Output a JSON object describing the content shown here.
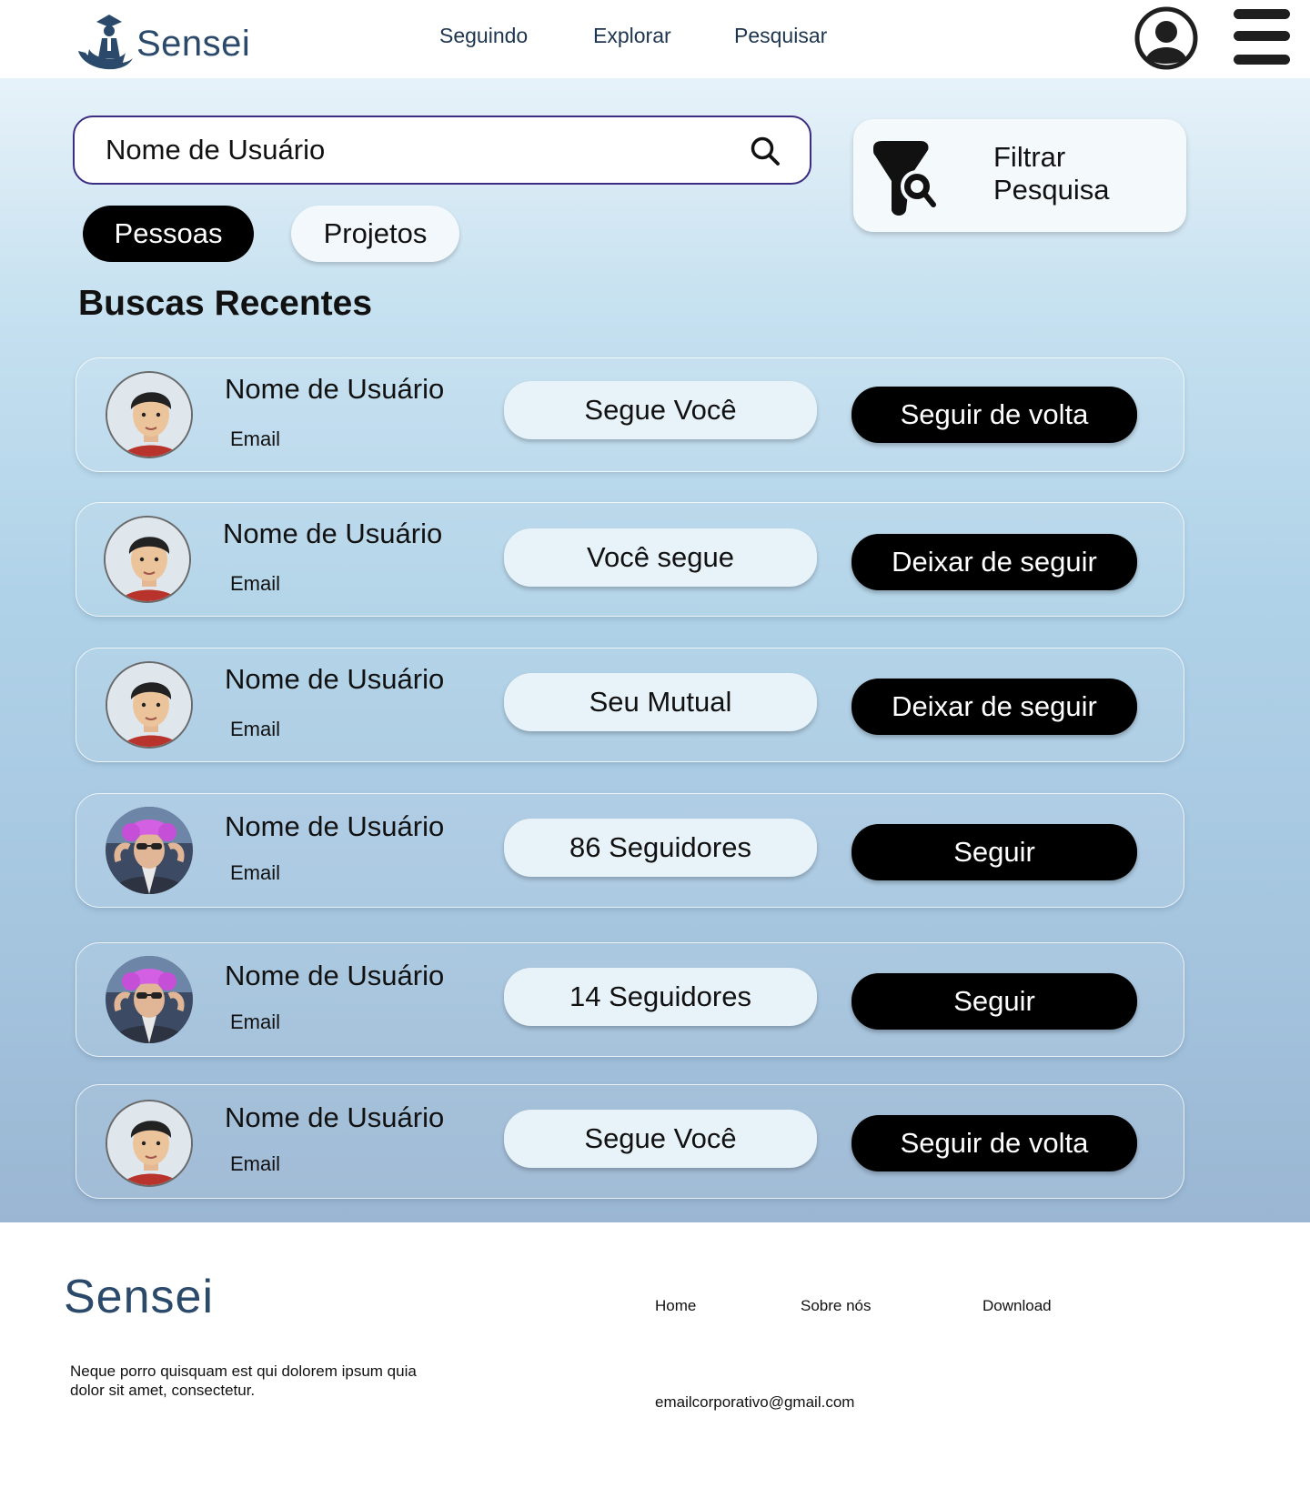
{
  "header": {
    "brand": "Sensei",
    "nav": [
      "Seguindo",
      "Explorar",
      "Pesquisar"
    ]
  },
  "search": {
    "placeholder": "Nome de Usuário",
    "value": ""
  },
  "filter": {
    "label": "Filtrar Pesquisa"
  },
  "tabs": [
    {
      "label": "Pessoas",
      "active": true
    },
    {
      "label": "Projetos",
      "active": false
    }
  ],
  "recent": {
    "title": "Buscas Recentes",
    "items": [
      {
        "name": "Nome de Usuário",
        "email": "Email",
        "status": "Segue Você",
        "action": "Seguir de volta",
        "avatar": "boy-avatar"
      },
      {
        "name": "Nome de Usuário",
        "email": "Email",
        "status": "Você segue",
        "action": "Deixar de seguir",
        "avatar": "boy-avatar"
      },
      {
        "name": "Nome de Usuário",
        "email": "Email",
        "status": "Seu Mutual",
        "action": "Deixar de seguir",
        "avatar": "boy-avatar"
      },
      {
        "name": "Nome de Usuário",
        "email": "Email",
        "status": "86 Seguidores",
        "action": "Seguir",
        "avatar": "pink-wig-avatar"
      },
      {
        "name": "Nome de Usuário",
        "email": "Email",
        "status": "14 Seguidores",
        "action": "Seguir",
        "avatar": "pink-wig-avatar"
      },
      {
        "name": "Nome de Usuário",
        "email": "Email",
        "status": "Segue Você",
        "action": "Seguir de volta",
        "avatar": "boy-avatar"
      }
    ]
  },
  "footer": {
    "brand": "Sensei",
    "description": "Neque porro quisquam est qui dolorem ipsum quia dolor sit amet, consectetur.",
    "links": [
      "Home",
      "Sobre nós",
      "Download"
    ],
    "email": "emailcorporativo@gmail.com"
  },
  "colors": {
    "brand": "#2b4a6b",
    "search_border": "#3a2d82",
    "action_bg": "#000000"
  }
}
